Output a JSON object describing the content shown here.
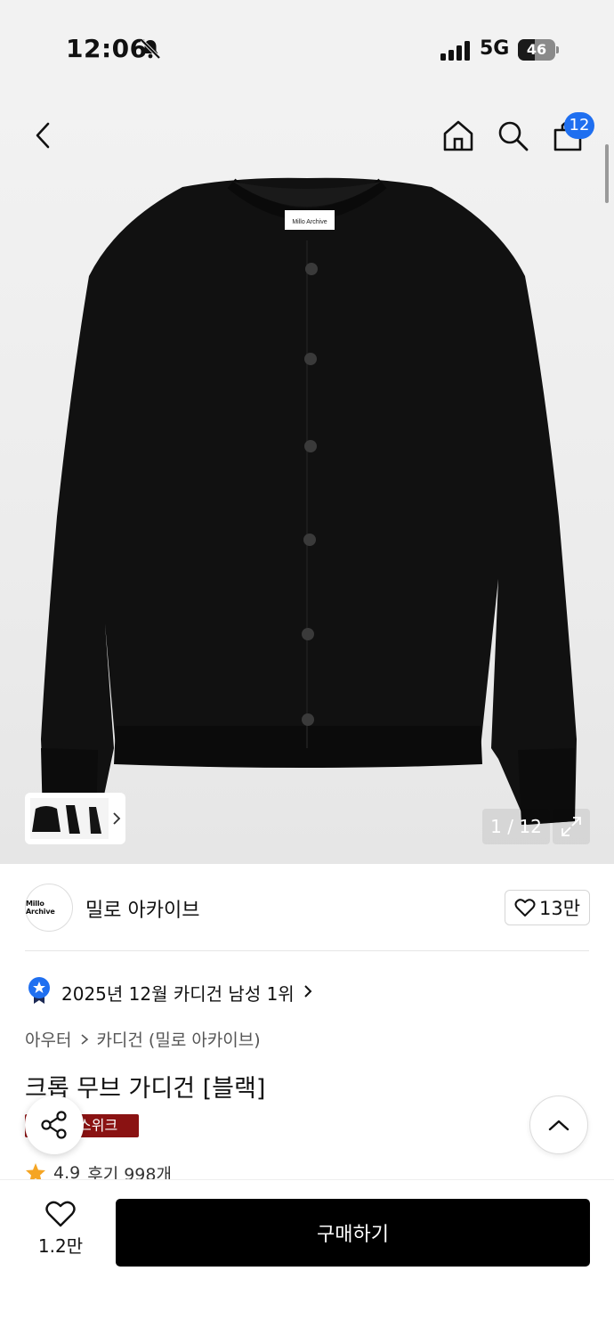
{
  "status_bar": {
    "time": "12:06",
    "network": "5G",
    "battery": "46",
    "battery_level": 0.46
  },
  "header": {
    "cart_badge": "12",
    "icons": [
      "back-icon",
      "home-icon",
      "search-icon",
      "shopping-bag-icon"
    ]
  },
  "gallery": {
    "label_on_garment": "Millo Archive",
    "page_counter": "1 / 12"
  },
  "brand": {
    "logo_text": "Millo Archive",
    "name": "밀로 아카이브",
    "like_count": "13만"
  },
  "ranking": {
    "text": "2025년 12월 카디건 남성 1위"
  },
  "breadcrumb": {
    "parent": "아우터",
    "current": "카디건 (밀로 아카이브)"
  },
  "product": {
    "title": "크롭 무브 가디건 [블랙]",
    "event_badge": "스위크",
    "rating": "4.9",
    "reviews": "후기 998개"
  },
  "bottom_bar": {
    "wish_count": "1.2만",
    "buy_label": "구매하기"
  },
  "colors": {
    "accent": "#1f6ff0",
    "badge_red": "#8a1212",
    "star": "#f5a524",
    "buy_button": "#000000"
  }
}
